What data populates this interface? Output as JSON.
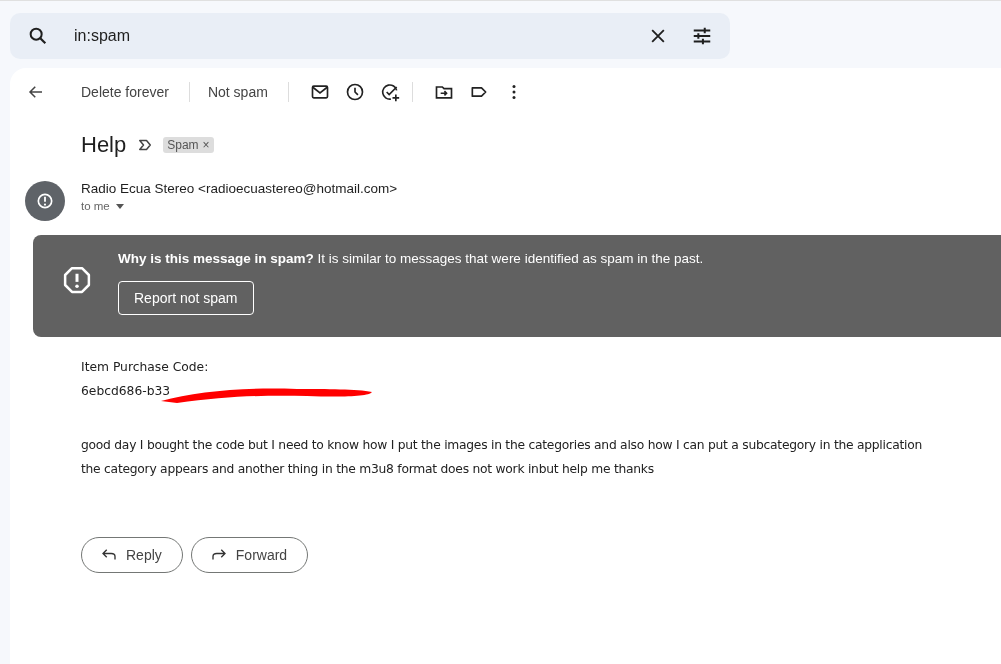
{
  "search": {
    "value": "in:spam"
  },
  "toolbar": {
    "actions": [
      "Delete forever",
      "Not spam"
    ]
  },
  "message": {
    "subject": "Help",
    "label": {
      "text": "Spam",
      "remove": "×"
    },
    "sender": "Radio Ecua Stereo <radioecuastereo@hotmail.com>",
    "recipient": "to me"
  },
  "spam_warning": {
    "text": "**Why is this message in spam?** It is similar to messages that were identified as spam in the past.",
    "button": "Report not spam"
  },
  "body": {
    "code_label": "Item Purchase Code:",
    "code": "6ebcd686-b33",
    "paragraph": [
      "good day I bought the code but I need to know how I put the images in the categories and also how I can put a subcategory in the application",
      "the category appears and another thing in the m3u8 format does not work inbut help me thanks"
    ]
  },
  "buttons": [
    {
      "kind": "reply",
      "label": "Reply"
    },
    {
      "kind": "forward",
      "label": "Forward"
    }
  ]
}
